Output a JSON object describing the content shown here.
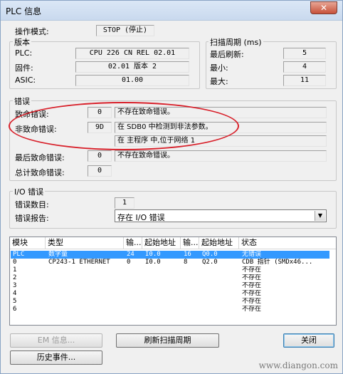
{
  "window": {
    "title": "PLC 信息",
    "close_label": "✕"
  },
  "mode": {
    "label": "操作模式:",
    "value": "STOP  (停止)"
  },
  "version": {
    "group_title": "版本",
    "plc_label": "PLC:",
    "plc_value": "CPU 226 CN REL 02.01",
    "firmware_label": "固件:",
    "firmware_value": "02.01 版本 2",
    "asic_label": "ASIC:",
    "asic_value": "01.00"
  },
  "scan": {
    "group_title": "扫描周期 (ms)",
    "last_label": "最后刷新:",
    "last_value": "5",
    "min_label": "最小:",
    "min_value": "4",
    "max_label": "最大:",
    "max_value": "11"
  },
  "errors": {
    "group_title": "错误",
    "fatal_label": "致命错误:",
    "fatal_code": "0",
    "fatal_text": "不存在致命错误。",
    "nonfatal_label": "非致命错误:",
    "nonfatal_code": "9D",
    "nonfatal_text": "在 SDB0 中检测到非法参数。",
    "nonfatal_text2": "在 主程序 中,位于网络 1",
    "last_fatal_label": "最后致命错误:",
    "last_fatal_code": "0",
    "last_fatal_text": "不存在致命错误。",
    "total_fatal_label": "总计致命错误:",
    "total_fatal_value": "0"
  },
  "io_errors": {
    "group_title": "I/O 错误",
    "count_label": "错误数目:",
    "count_value": "1",
    "report_label": "错误报告:",
    "report_value": "存在 I/O 错误"
  },
  "table": {
    "headers": [
      "模块",
      "类型",
      "输...",
      "起始地址",
      "输...",
      "起始地址",
      "状态"
    ],
    "rows": [
      [
        "PLC",
        "数字量",
        "24",
        "I0.0",
        "16",
        "Q0.0",
        "无错误"
      ],
      [
        "0",
        "CP243-1 ETHERNET",
        "0",
        "I0.0",
        "8",
        "Q2.0",
        "CDB 指针 (SMDx46..."
      ],
      [
        "1",
        "",
        "",
        "",
        "",
        "",
        "不存在"
      ],
      [
        "2",
        "",
        "",
        "",
        "",
        "",
        "不存在"
      ],
      [
        "3",
        "",
        "",
        "",
        "",
        "",
        "不存在"
      ],
      [
        "4",
        "",
        "",
        "",
        "",
        "",
        "不存在"
      ],
      [
        "5",
        "",
        "",
        "",
        "",
        "",
        "不存在"
      ],
      [
        "6",
        "",
        "",
        "",
        "",
        "",
        "不存在"
      ]
    ]
  },
  "buttons": {
    "em_info": "EM 信息...",
    "refresh": "刷新扫描周期",
    "close": "关闭",
    "history": "历史事件..."
  },
  "watermark": "www.diangon.com"
}
